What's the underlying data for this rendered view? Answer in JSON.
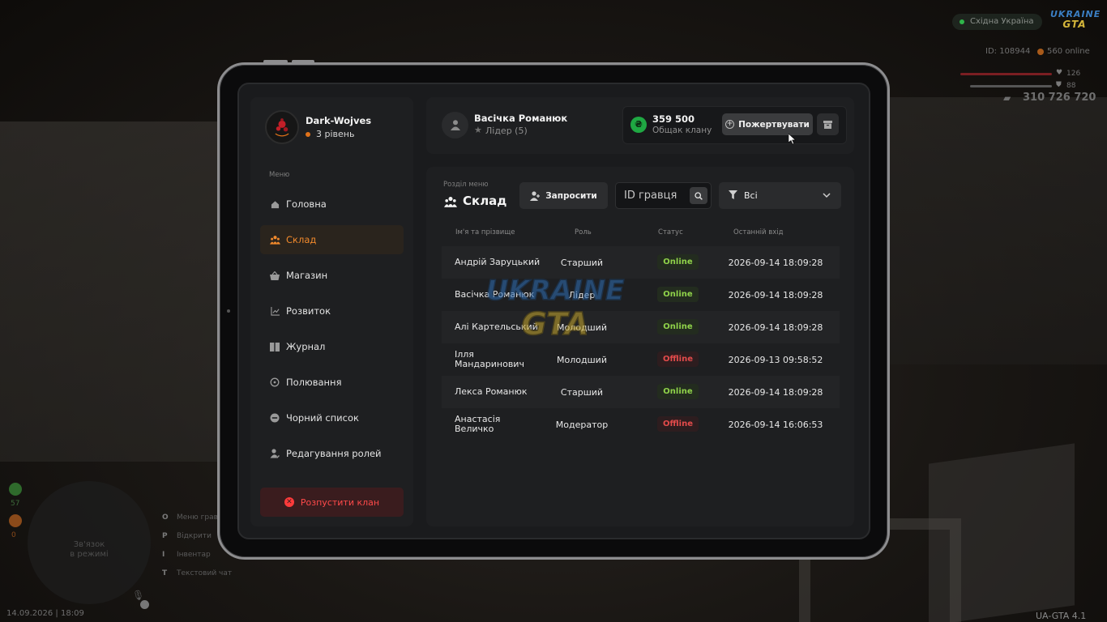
{
  "hud": {
    "server": "Східна Україна",
    "logo_top": "UKRAINE",
    "logo_bottom": "GTA",
    "player_id": "ID: 108944",
    "online": "560 online",
    "health": "126",
    "armor": "88",
    "money": "310 726 720",
    "minimap_text": "Зв'язок\nв режимі",
    "counter_green": "57",
    "counter_orange": "0",
    "keys": [
      {
        "key": "O",
        "label": "Меню гравця"
      },
      {
        "key": "P",
        "label": "Відкрити"
      },
      {
        "key": "I",
        "label": "Інвентар"
      },
      {
        "key": "T",
        "label": "Текстовий чат"
      }
    ],
    "datetime": "14.09.2026 | 18:09",
    "version": "UA-GTA 4.1"
  },
  "clan": {
    "name": "Dark-Wojves",
    "level": "3 рівень"
  },
  "sidebar": {
    "caption": "Меню",
    "items": [
      {
        "label": "Головна",
        "icon": "home-icon"
      },
      {
        "label": "Склад",
        "icon": "people-icon"
      },
      {
        "label": "Магазин",
        "icon": "basket-icon"
      },
      {
        "label": "Розвиток",
        "icon": "chart-icon"
      },
      {
        "label": "Журнал",
        "icon": "book-icon"
      },
      {
        "label": "Полювання",
        "icon": "target-icon"
      },
      {
        "label": "Чорний список",
        "icon": "block-icon"
      },
      {
        "label": "Редагування ролей",
        "icon": "user-edit-icon"
      }
    ],
    "active_index": 1,
    "disband_label": "Розпустити клан"
  },
  "user": {
    "name": "Васічка Романюк",
    "role": "Лідер (5)"
  },
  "bank": {
    "currency_symbol": "₴",
    "amount": "359 500",
    "label": "Общак клану",
    "donate_label": "Пожертвувати"
  },
  "main": {
    "caption": "Розділ меню",
    "title": "Склад",
    "invite_label": "Запросити",
    "search_placeholder": "ID гравця",
    "filter_value": "Всі",
    "columns": [
      "Ім'я та прізвище",
      "Роль",
      "Статус",
      "Останній вхід"
    ],
    "members": [
      {
        "name": "Андрій Заруцький",
        "role": "Старший",
        "status": "Online",
        "last": "2026-09-14 18:09:28"
      },
      {
        "name": "Васічка Романюк",
        "role": "Лідер",
        "status": "Online",
        "last": "2026-09-14 18:09:28"
      },
      {
        "name": "Алі Картельський",
        "role": "Молодший",
        "status": "Online",
        "last": "2026-09-14 18:09:28"
      },
      {
        "name": "Ілля Мандаринович",
        "role": "Молодший",
        "status": "Offline",
        "last": "2026-09-13 09:58:52"
      },
      {
        "name": "Лекса Романюк",
        "role": "Старший",
        "status": "Online",
        "last": "2026-09-14 18:09:28"
      },
      {
        "name": "Анастасія Величко",
        "role": "Модератор",
        "status": "Offline",
        "last": "2026-09-14 16:06:53"
      }
    ]
  },
  "watermark": {
    "top": "UKRAINE",
    "bottom": "GTA"
  },
  "colors": {
    "accent": "#f0892c",
    "online": "#8fd24a",
    "offline": "#e34b4b",
    "danger": "#ff4a4a",
    "coin": "#1fa843"
  }
}
